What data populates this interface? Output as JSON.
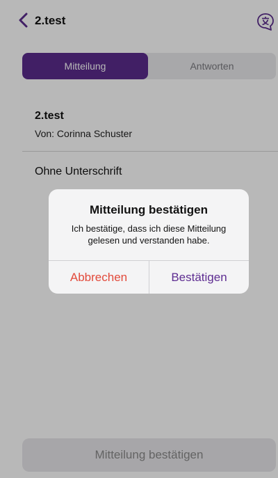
{
  "nav": {
    "title": "2.test",
    "back_icon": "chevron-left-icon",
    "translate_icon": "translate-bubble-icon"
  },
  "tabs": [
    {
      "label": "Mitteilung",
      "active": true
    },
    {
      "label": "Antworten",
      "active": false
    }
  ],
  "message": {
    "title": "2.test",
    "from": "Von: Corinna Schuster",
    "body": "Ohne Unterschrift"
  },
  "footer": {
    "confirm_label": "Mitteilung bestätigen"
  },
  "alert": {
    "title": "Mitteilung bestätigen",
    "text": "Ich bestätige, dass ich diese Mitteilung gelesen und verstanden habe.",
    "cancel_label": "Abbrechen",
    "confirm_label": "Bestätigen"
  },
  "colors": {
    "accent": "#5a2b8c",
    "destructive": "#e24a3b"
  }
}
